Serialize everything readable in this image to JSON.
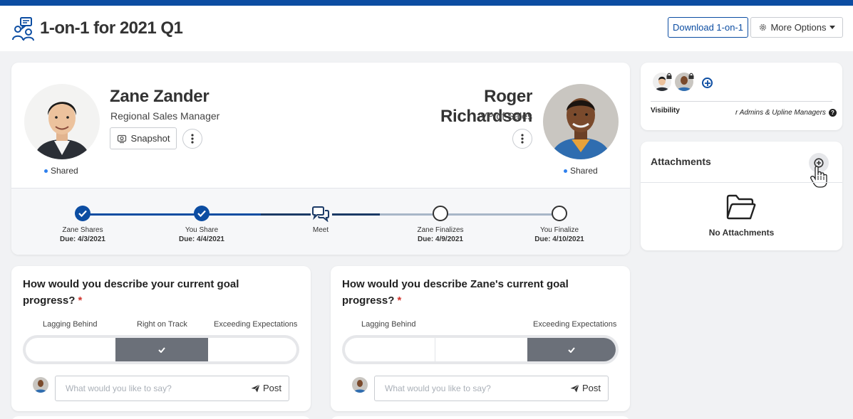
{
  "header": {
    "title": "1-on-1 for 2021 Q1",
    "download_label": "Download 1-on-1",
    "more_label": "More Options"
  },
  "employee": {
    "name": "Zane Zander",
    "role": "Regional Sales Manager",
    "snapshot_label": "Snapshot",
    "status": "Shared"
  },
  "manager": {
    "name": "Roger Richardson",
    "role": "VP of Sales",
    "status": "Shared"
  },
  "timeline": [
    {
      "label": "Zane Shares",
      "due": "Due: 4/3/2021",
      "state": "done"
    },
    {
      "label": "You Share",
      "due": "Due: 4/4/2021",
      "state": "done"
    },
    {
      "label": "Meet",
      "due": "",
      "state": "current"
    },
    {
      "label": "Zane Finalizes",
      "due": "Due: 4/9/2021",
      "state": "todo"
    },
    {
      "label": "You Finalize",
      "due": "Due: 4/10/2021",
      "state": "todo"
    }
  ],
  "visibility": {
    "label": "Visibility",
    "value": "r Admins & Upline Managers"
  },
  "attachments": {
    "title": "Attachments",
    "empty": "No Attachments"
  },
  "questions": [
    {
      "title": "How would you describe your current goal progress?",
      "required_mark": "*",
      "options": [
        "Lagging Behind",
        "Right on Track",
        "Exceeding Expectations"
      ],
      "selected_index": 1,
      "placeholder": "What would you like to say?",
      "post_label": "Post"
    },
    {
      "title": "How would you describe Zane's current goal progress?",
      "required_mark": "*",
      "options": [
        "Lagging Behind",
        "Exceeding Expectations"
      ],
      "selected_index": 2,
      "placeholder": "What would you like to say?",
      "post_label": "Post"
    }
  ],
  "colors": {
    "brand": "#0c4da2",
    "shared_dot": "#2f80ed",
    "selected_segment": "#6b7079",
    "required": "#d0342c"
  },
  "icons": [
    "people-chat-icon",
    "gear-icon",
    "caret-down-icon",
    "snapshot-icon",
    "kebab-icon",
    "check-icon",
    "chat-bubbles-icon",
    "lock-icon",
    "plus-circle-icon",
    "help-icon",
    "folder-icon",
    "hand-cursor-icon",
    "paper-plane-icon"
  ]
}
